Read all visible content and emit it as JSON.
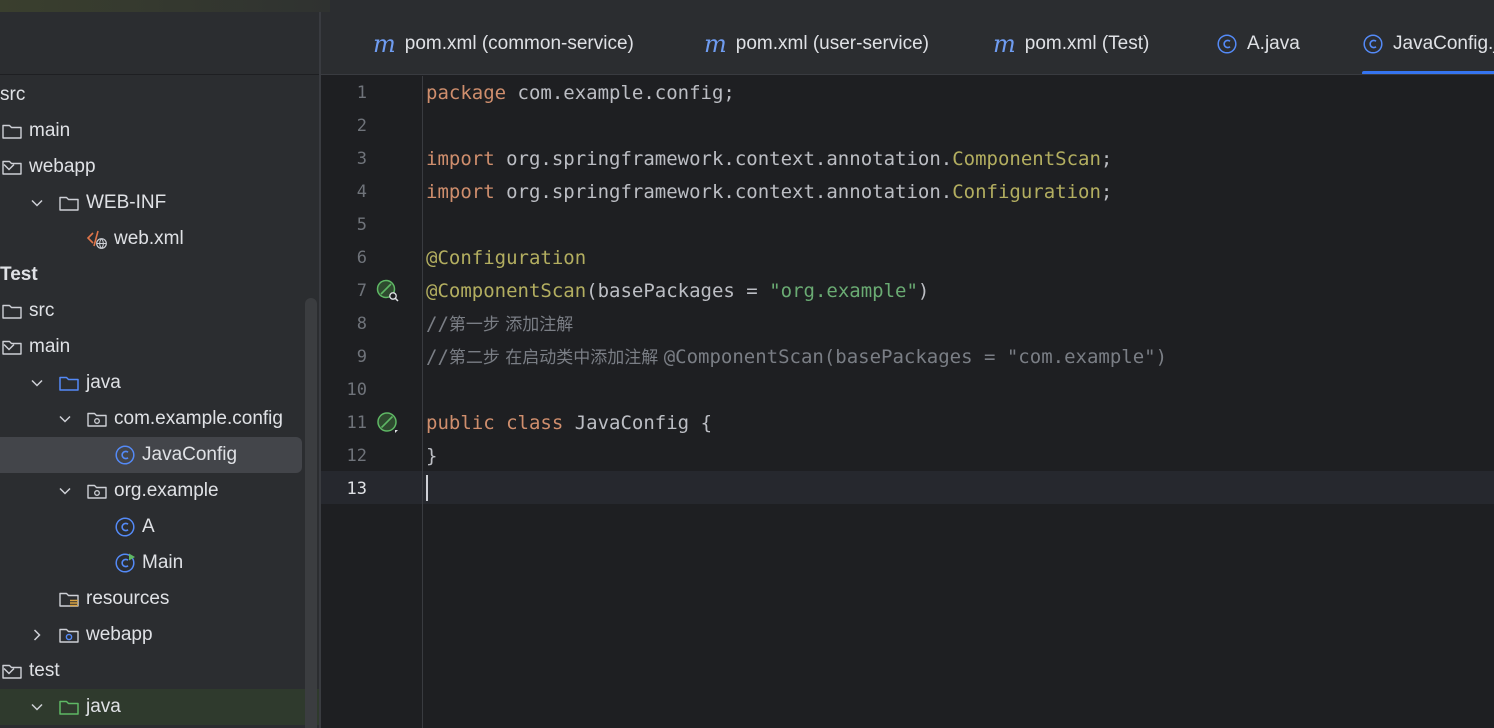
{
  "project_tree": {
    "items": [
      {
        "label": "src",
        "icon": "none",
        "depth": 0,
        "chevron": "none",
        "bold": false
      },
      {
        "label": "main",
        "icon": "folder-icon",
        "depth": 0,
        "chevron": "none",
        "bold": false
      },
      {
        "label": "webapp",
        "icon": "folder-icon",
        "depth": 0,
        "chevron": "down",
        "bold": false
      },
      {
        "label": "WEB-INF",
        "icon": "folder-icon",
        "depth": 1,
        "chevron": "down",
        "bold": false
      },
      {
        "label": "web.xml",
        "icon": "web-xml-icon",
        "depth": 2,
        "chevron": "none",
        "bold": false
      },
      {
        "label": "Test",
        "icon": "none",
        "depth": 0,
        "chevron": "none",
        "bold": true
      },
      {
        "label": "src",
        "icon": "folder-icon",
        "depth": 0,
        "chevron": "none",
        "bold": false
      },
      {
        "label": "main",
        "icon": "folder-icon",
        "depth": 0,
        "chevron": "down",
        "bold": false
      },
      {
        "label": "java",
        "icon": "source-folder-icon",
        "depth": 1,
        "chevron": "down",
        "bold": false
      },
      {
        "label": "com.example.config",
        "icon": "package-icon",
        "depth": 2,
        "chevron": "down",
        "bold": false
      },
      {
        "label": "JavaConfig",
        "icon": "class-icon",
        "depth": 3,
        "chevron": "none",
        "bold": false,
        "selected": true
      },
      {
        "label": "org.example",
        "icon": "package-icon",
        "depth": 2,
        "chevron": "down",
        "bold": false
      },
      {
        "label": "A",
        "icon": "class-icon",
        "depth": 3,
        "chevron": "none",
        "bold": false
      },
      {
        "label": "Main",
        "icon": "runnable-class-icon",
        "depth": 3,
        "chevron": "none",
        "bold": false
      },
      {
        "label": "resources",
        "icon": "resources-folder-icon",
        "depth": 1,
        "chevron": "none",
        "bold": false
      },
      {
        "label": "webapp",
        "icon": "web-folder-icon",
        "depth": 1,
        "chevron": "right",
        "bold": false
      },
      {
        "label": "test",
        "icon": "folder-icon",
        "depth": 0,
        "chevron": "down",
        "bold": false
      },
      {
        "label": "java",
        "icon": "test-folder-icon",
        "depth": 1,
        "chevron": "down",
        "bold": false,
        "highlight": true
      }
    ]
  },
  "tabs": [
    {
      "label": "pom.xml (common-service)",
      "icon": "maven-icon",
      "glyph": "m"
    },
    {
      "label": "pom.xml (user-service)",
      "icon": "maven-icon",
      "glyph": "m"
    },
    {
      "label": "pom.xml (Test)",
      "icon": "maven-icon",
      "glyph": "m"
    },
    {
      "label": "A.java",
      "icon": "class-icon",
      "glyph": "C"
    },
    {
      "label": "JavaConfig.java",
      "icon": "class-icon",
      "glyph": "C",
      "active": true
    }
  ],
  "editor": {
    "current_line": 13,
    "lines": [
      {
        "n": "1",
        "parts": [
          {
            "t": "package",
            "c": "kw"
          },
          {
            "t": " com.example.config;",
            "c": ""
          }
        ]
      },
      {
        "n": "2",
        "parts": []
      },
      {
        "n": "3",
        "parts": [
          {
            "t": "import",
            "c": "kw"
          },
          {
            "t": " org.springframework.context.annotation.",
            "c": ""
          },
          {
            "t": "ComponentScan",
            "c": "ann"
          },
          {
            "t": ";",
            "c": ""
          }
        ]
      },
      {
        "n": "4",
        "parts": [
          {
            "t": "import",
            "c": "kw"
          },
          {
            "t": " org.springframework.context.annotation.",
            "c": ""
          },
          {
            "t": "Configuration",
            "c": "ann"
          },
          {
            "t": ";",
            "c": ""
          }
        ]
      },
      {
        "n": "5",
        "parts": []
      },
      {
        "n": "6",
        "parts": [
          {
            "t": "@Configuration",
            "c": "ann"
          }
        ]
      },
      {
        "n": "7",
        "gutter": "bean-search-icon",
        "parts": [
          {
            "t": "@ComponentScan",
            "c": "ann"
          },
          {
            "t": "(basePackages = ",
            "c": ""
          },
          {
            "t": "\"org.example\"",
            "c": "str"
          },
          {
            "t": ")",
            "c": ""
          }
        ]
      },
      {
        "n": "8",
        "parts": [
          {
            "t": "//",
            "c": "cmt"
          },
          {
            "t": "第一步 添加注解",
            "c": "cmt cmt-cjk"
          }
        ]
      },
      {
        "n": "9",
        "parts": [
          {
            "t": "//",
            "c": "cmt"
          },
          {
            "t": "第二步 在启动类中添加注解 ",
            "c": "cmt cmt-cjk"
          },
          {
            "t": "@ComponentScan(basePackages = \"com.example\")",
            "c": "cmt"
          }
        ]
      },
      {
        "n": "10",
        "parts": []
      },
      {
        "n": "11",
        "gutter": "bean-icon",
        "parts": [
          {
            "t": "public",
            "c": "kw"
          },
          {
            "t": " ",
            "c": ""
          },
          {
            "t": "class",
            "c": "kw"
          },
          {
            "t": " JavaConfig {",
            "c": ""
          }
        ]
      },
      {
        "n": "12",
        "parts": [
          {
            "t": "}",
            "c": ""
          }
        ]
      },
      {
        "n": "13",
        "parts": []
      }
    ]
  },
  "colors": {
    "keyword": "#cf8e6d",
    "annotation": "#b3ae60",
    "string": "#6aab73",
    "comment": "#7a7e85",
    "accent": "#3574f0"
  }
}
